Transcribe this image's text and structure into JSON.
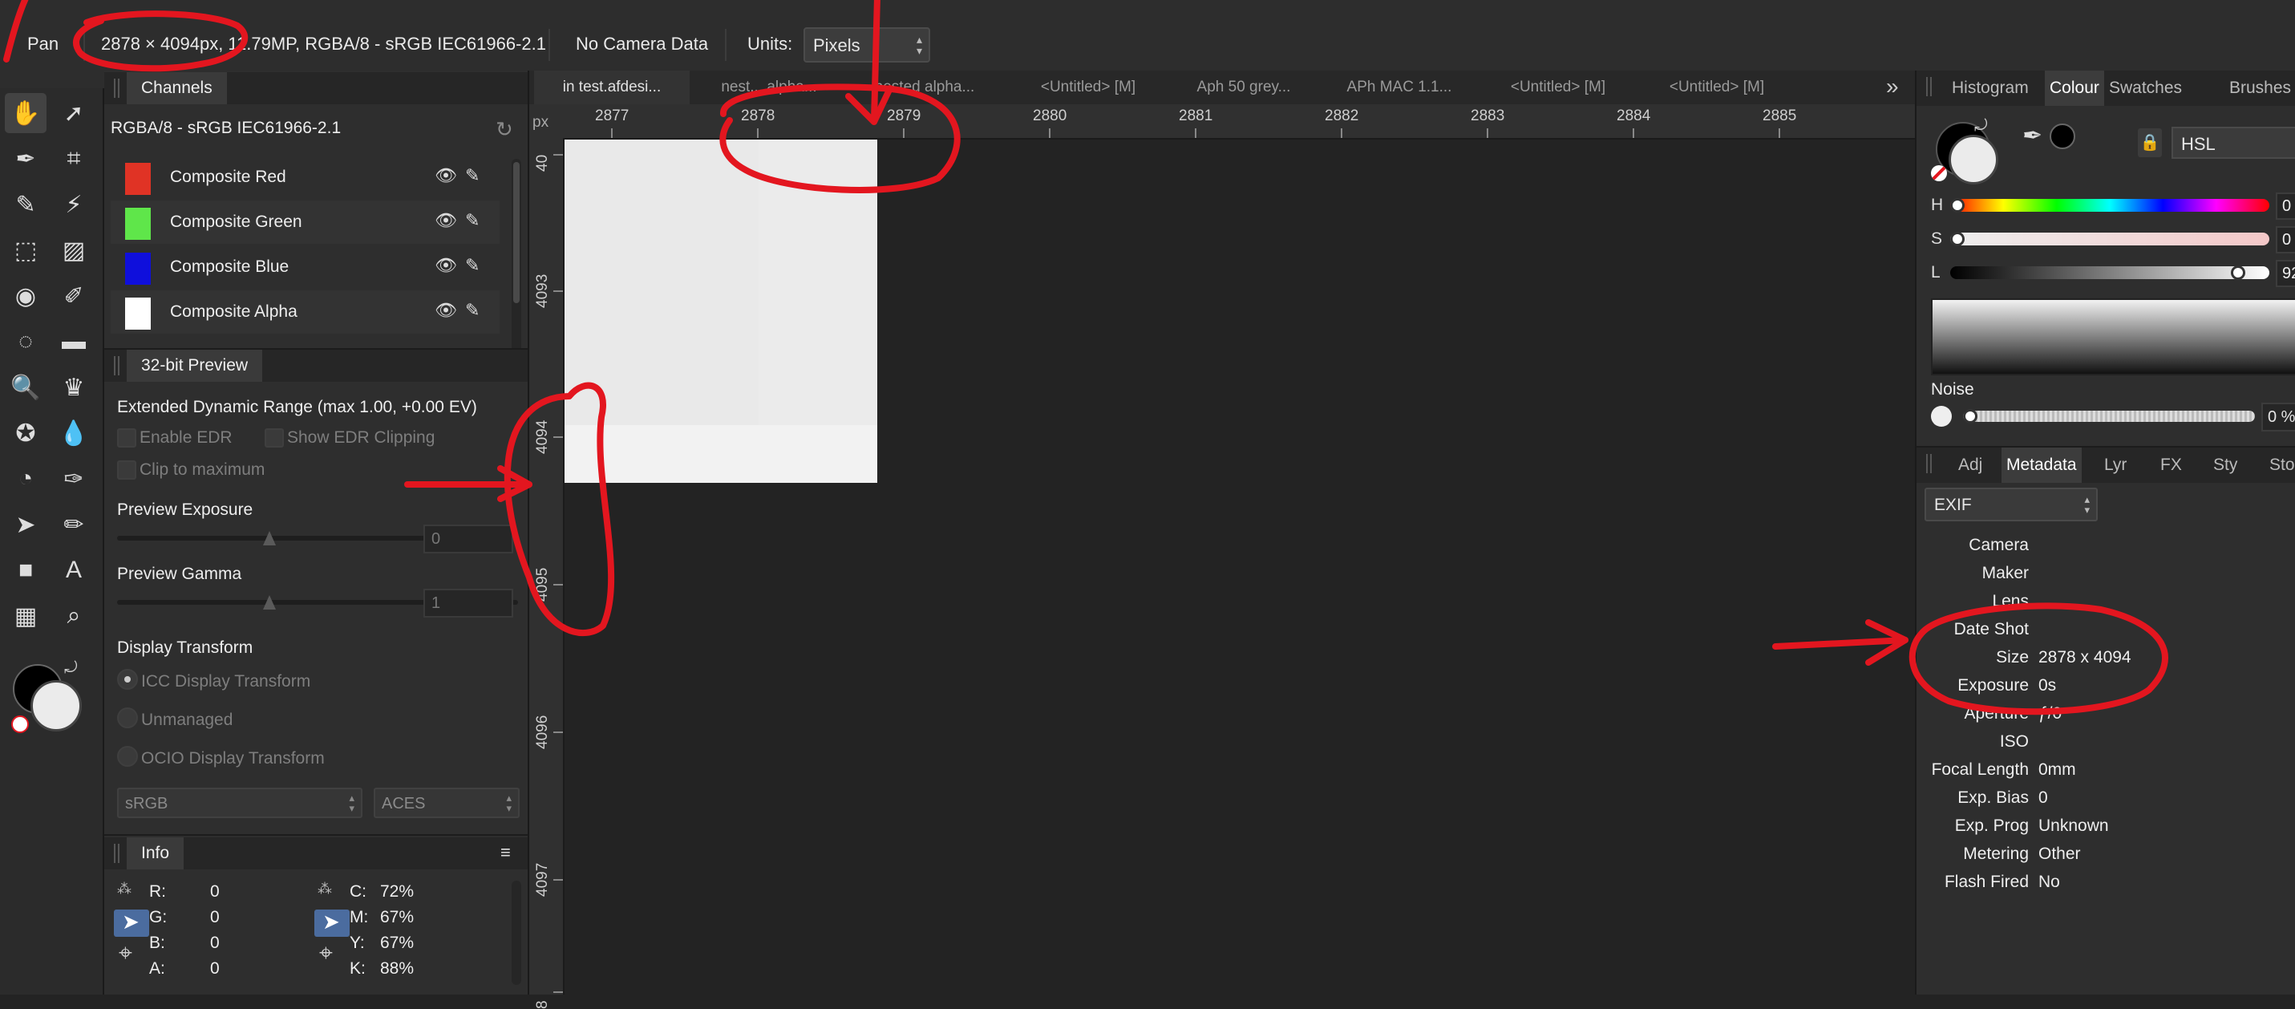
{
  "context_bar": {
    "tool": "Pan",
    "document_info": "2878 × 4094px, 11.79MP, RGBA/8 - sRGB IEC61966-2.1",
    "camera": "No Camera Data",
    "units_label": "Units:",
    "units_value": "Pixels"
  },
  "toolbar": {
    "tools": [
      "pan-tool",
      "move-tool",
      "color-picker-tool",
      "crop-tool",
      "paint-brush-tool",
      "magic-wand-tool",
      "marquee-tool",
      "flood-fill-tool",
      "color-wheel-tool",
      "brush-tool",
      "selection-brush-tool",
      "eraser-tool",
      "zoom-tool",
      "clone-tool",
      "sponge-tool",
      "blur-tool",
      "dodge-tool",
      "pen-tool",
      "node-tool",
      "pencil-tool",
      "rectangle-tool",
      "text-tool",
      "mesh-tool",
      "magnifier-tool"
    ],
    "icons": [
      "✋",
      "➚",
      "✒",
      "⌗",
      "✎",
      "⚡",
      "⬚",
      "▨",
      "◉",
      "✐",
      "◌",
      "▬",
      "🔍",
      "♛",
      "✪",
      "💧",
      "◔",
      "✑",
      "➤",
      "✏",
      "■",
      "A",
      "▦",
      "⌕"
    ]
  },
  "channels": {
    "tab": "Channels",
    "profile": "RGBA/8 - sRGB IEC61966-2.1",
    "items": [
      {
        "label": "Composite Red",
        "color": "#e03325"
      },
      {
        "label": "Composite Green",
        "color": "#5fe64a"
      },
      {
        "label": "Composite Blue",
        "color": "#0f0fdc"
      },
      {
        "label": "Composite Alpha",
        "color": "#ffffff"
      }
    ]
  },
  "preview32": {
    "tab": "32-bit Preview",
    "edr_title": "Extended Dynamic Range (max 1.00, +0.00 EV)",
    "enable_edr": "Enable EDR",
    "show_edr_clipping": "Show EDR Clipping",
    "clip_to_max": "Clip to maximum",
    "exposure_label": "Preview Exposure",
    "exposure_value": "0",
    "exposure_level": 0.5,
    "gamma_label": "Preview Gamma",
    "gamma_value": "1",
    "gamma_level": 0.5,
    "display_transform": "Display Transform",
    "icc": "ICC Display Transform",
    "unmanaged": "Unmanaged",
    "ocio": "OCIO Display Transform",
    "dropdown1": "sRGB",
    "dropdown2": "ACES"
  },
  "info": {
    "tab": "Info",
    "rgba": [
      {
        "k": "R:",
        "v": "0"
      },
      {
        "k": "G:",
        "v": "0"
      },
      {
        "k": "B:",
        "v": "0"
      },
      {
        "k": "A:",
        "v": "0"
      }
    ],
    "cmyk": [
      {
        "k": "C:",
        "v": "72%"
      },
      {
        "k": "M:",
        "v": "67%"
      },
      {
        "k": "Y:",
        "v": "67%"
      },
      {
        "k": "K:",
        "v": "88%"
      }
    ]
  },
  "doc_tabs": [
    "in test.afdesi...",
    "nest... alpha...",
    "nested alpha...",
    "<Untitled> [M]",
    "Aph 50 grey...",
    "APh MAC 1.1...",
    "<Untitled> [M]",
    "<Untitled> [M]"
  ],
  "ruler": {
    "unit": "px",
    "h_labels": [
      "2877",
      "2878",
      "2879",
      "2880",
      "2881",
      "2882",
      "2883",
      "2884",
      "2885"
    ],
    "v_labels": [
      "40",
      "4093",
      "4094",
      "4095",
      "4096",
      "4097",
      "8"
    ]
  },
  "right_tabs_top": [
    "Histogram",
    "Colour",
    "Swatches",
    "Brushes"
  ],
  "colour": {
    "model": "HSL",
    "h_label": "H",
    "h_value": "0",
    "h_level": 0.0,
    "s_label": "S",
    "s_value": "0",
    "s_level": 0.0,
    "l_label": "L",
    "l_value": "92",
    "l_level": 0.92,
    "noise_label": "Noise",
    "noise_value": "0 %",
    "fill_color": "#ebebeb",
    "stroke_color": "#000000"
  },
  "right_tabs_bottom": [
    "Adj",
    "Metadata",
    "Lyr",
    "FX",
    "Sty",
    "Sto"
  ],
  "metadata": {
    "preset": "EXIF",
    "rows": [
      {
        "k": "Camera",
        "v": ""
      },
      {
        "k": "Maker",
        "v": ""
      },
      {
        "k": "Lens",
        "v": ""
      },
      {
        "k": "Date Shot",
        "v": ""
      },
      {
        "k": "Size",
        "v": "2878 x 4094"
      },
      {
        "k": "Exposure",
        "v": "0s"
      },
      {
        "k": "Aperture",
        "v": "ƒ/0"
      },
      {
        "k": "ISO",
        "v": ""
      },
      {
        "k": "Focal Length",
        "v": "0mm"
      },
      {
        "k": "Exp. Bias",
        "v": "0"
      },
      {
        "k": "Exp. Prog",
        "v": "Unknown"
      },
      {
        "k": "Metering",
        "v": "Other"
      },
      {
        "k": "Flash Fired",
        "v": "No"
      }
    ]
  },
  "accent_annotation": "#e3161f"
}
